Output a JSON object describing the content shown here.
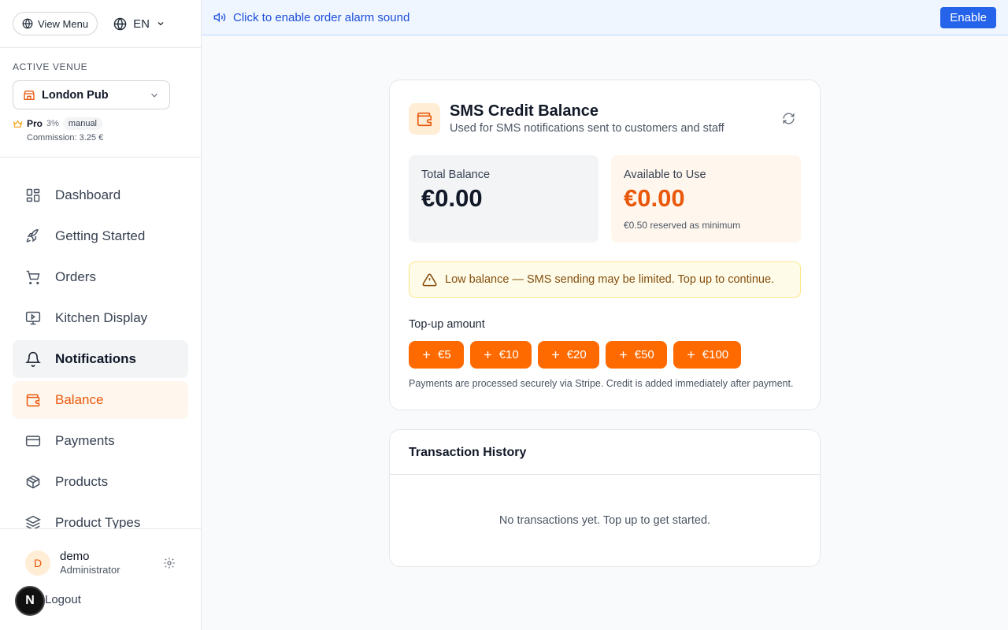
{
  "sidebar": {
    "view_menu_label": "View Menu",
    "language": "EN",
    "active_venue_label": "ACTIVE VENUE",
    "venue_name": "London Pub",
    "plan": {
      "name": "Pro",
      "rate": "3%",
      "mode": "manual"
    },
    "commission": "Commission: 3.25 €",
    "nav_items": [
      {
        "label": "Dashboard",
        "icon": "dashboard-icon"
      },
      {
        "label": "Getting Started",
        "icon": "rocket-icon"
      },
      {
        "label": "Orders",
        "icon": "cart-icon"
      },
      {
        "label": "Kitchen Display",
        "icon": "monitor-icon"
      },
      {
        "label": "Notifications",
        "icon": "bell-icon"
      },
      {
        "label": "Balance",
        "icon": "wallet-icon"
      },
      {
        "label": "Payments",
        "icon": "credit-card-icon"
      },
      {
        "label": "Products",
        "icon": "box-icon"
      },
      {
        "label": "Product Types",
        "icon": "layers-icon"
      }
    ],
    "active_item": "Balance",
    "user": {
      "initial": "D",
      "name": "demo",
      "role": "Administrator"
    },
    "logout_label": "Logout",
    "framework_badge": "N"
  },
  "alarm_bar": {
    "text": "Click to enable order alarm sound",
    "button_label": "Enable"
  },
  "balance_card": {
    "title": "SMS Credit Balance",
    "subtitle": "Used for SMS notifications sent to customers and staff",
    "total_label": "Total Balance",
    "total_value": "€0.00",
    "available_label": "Available to Use",
    "available_value": "€0.00",
    "reserved_note": "€0.50 reserved as minimum",
    "warning": "Low balance — SMS sending may be limited. Top up to continue.",
    "topup_label": "Top-up amount",
    "topup_amounts": [
      "€5",
      "€10",
      "€20",
      "€50",
      "€100"
    ],
    "payment_note": "Payments are processed securely via Stripe. Credit is added immediately after payment."
  },
  "history_card": {
    "title": "Transaction History",
    "empty_text": "No transactions yet. Top up to get started."
  },
  "colors": {
    "accent": "#ff6a00",
    "accent_text": "#ea580c",
    "info_bar_bg": "#eff6ff",
    "info_button": "#2563eb",
    "warning_bg": "#fefce8"
  }
}
